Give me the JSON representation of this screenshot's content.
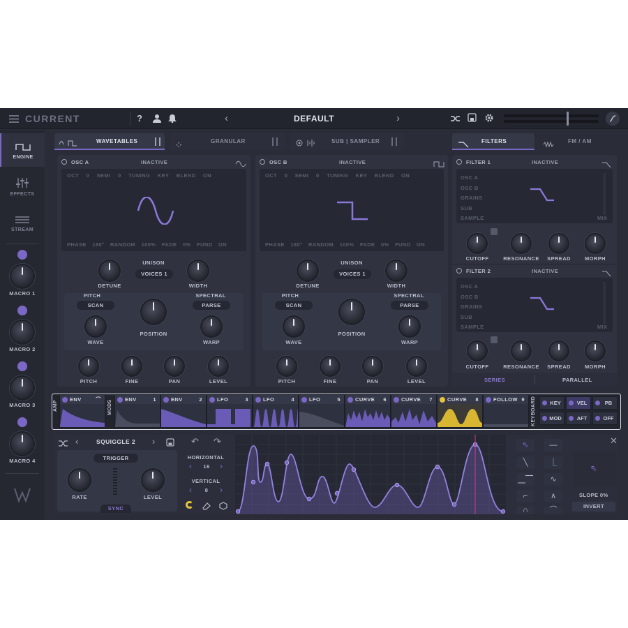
{
  "app": {
    "title": "CURRENT",
    "preset": "DEFAULT"
  },
  "topbar": {
    "help": "?",
    "prev": "‹",
    "next": "›"
  },
  "sidebar": {
    "items": [
      {
        "label": "ENGINE",
        "icon": "engine-wave-icon"
      },
      {
        "label": "EFFECTS",
        "icon": "effects-sliders-icon"
      },
      {
        "label": "STREAM",
        "icon": "stream-icon"
      }
    ],
    "macros": [
      "MACRO 1",
      "MACRO 2",
      "MACRO 3",
      "MACRO 4"
    ]
  },
  "tabs": {
    "wavetables": "WAVETABLES",
    "granular": "GRANULAR",
    "sub_sampler": "SUB | SAMPLER",
    "filters": "FILTERS",
    "fm_am": "FM / AM"
  },
  "osc_a": {
    "name": "OSC A",
    "state": "INACTIVE",
    "params_top": [
      "OCT",
      "0",
      "SEMI",
      "0",
      "TUNING",
      "KEY",
      "BLEND",
      "ON"
    ],
    "params_bottom": [
      "PHASE",
      "180°",
      "RANDOM",
      "100%",
      "FADE",
      "0%",
      "FUND",
      "ON"
    ],
    "unison": "UNISON",
    "voices_label": "VOICES",
    "voices": "1",
    "detune": "DETUNE",
    "width": "WIDTH",
    "pitch_label": "PITCH",
    "pitch_mode": "SCAN",
    "spectral_label": "SPECTRAL",
    "spectral_mode": "PARSE",
    "wave": "WAVE",
    "position": "POSITION",
    "warp": "WARP",
    "pitch": "PITCH",
    "fine": "FINE",
    "pan": "PAN",
    "level": "LEVEL"
  },
  "osc_b": {
    "name": "OSC B",
    "state": "INACTIVE",
    "params_top": [
      "OCT",
      "0",
      "SEMI",
      "0",
      "TUNING",
      "KEY",
      "BLEND",
      "ON"
    ],
    "params_bottom": [
      "PHASE",
      "180°",
      "RANDOM",
      "100%",
      "FADE",
      "0%",
      "FUND",
      "ON"
    ],
    "unison": "UNISON",
    "voices_label": "VOICES",
    "voices": "1",
    "detune": "DETUNE",
    "width": "WIDTH",
    "pitch_label": "PITCH",
    "pitch_mode": "SCAN",
    "spectral_label": "SPECTRAL",
    "spectral_mode": "PARSE",
    "wave": "WAVE",
    "position": "POSITION",
    "warp": "WARP",
    "pitch": "PITCH",
    "fine": "FINE",
    "pan": "PAN",
    "level": "LEVEL"
  },
  "filter1": {
    "name": "FILTER 1",
    "state": "INACTIVE",
    "routes": [
      "OSC A",
      "OSC B",
      "GRAINS",
      "SUB",
      "SAMPLE"
    ],
    "mix": "MIX",
    "cutoff": "CUTOFF",
    "resonance": "RESONANCE",
    "spread": "SPREAD",
    "morph": "MORPH"
  },
  "filter2": {
    "name": "FILTER 2",
    "state": "INACTIVE",
    "routes": [
      "OSC A",
      "OSC B",
      "GRAINS",
      "SUB",
      "SAMPLE"
    ],
    "mix": "MIX",
    "cutoff": "CUTOFF",
    "resonance": "RESONANCE",
    "spread": "SPREAD",
    "morph": "MORPH"
  },
  "filter_mode": {
    "series": "SERIES",
    "parallel": "PARALLEL"
  },
  "mod_strip": {
    "amp": "AMP",
    "mods": "MODS",
    "keyboard": "KEYBOARD",
    "amp_env": {
      "label": "ENV"
    },
    "slots": [
      {
        "label": "ENV",
        "num": "1"
      },
      {
        "label": "ENV",
        "num": "2"
      },
      {
        "label": "LFO",
        "num": "3"
      },
      {
        "label": "LFO",
        "num": "4"
      },
      {
        "label": "LFO",
        "num": "5"
      },
      {
        "label": "CURVE",
        "num": "6"
      },
      {
        "label": "CURVE",
        "num": "7"
      },
      {
        "label": "CURVE",
        "num": "8"
      },
      {
        "label": "FOLLOW",
        "num": "9"
      }
    ],
    "keys": [
      "KEY",
      "VEL",
      "PB",
      "MOD",
      "AFT",
      "OFF"
    ]
  },
  "lfo_editor": {
    "preset": "SQUIGGLE 2",
    "trigger": "TRIGGER",
    "rate": "RATE",
    "level": "LEVEL",
    "sync": "SYNC",
    "horizontal": "HORIZONTAL",
    "horizontal_value": "16",
    "vertical": "VERTICAL",
    "vertical_value": "8",
    "slope": "SLOPE",
    "slope_value": "0%",
    "invert": "INVERT"
  },
  "colors": {
    "accent": "#7b68c6",
    "highlight": "#e5c43b",
    "panel": "#30333f",
    "bg": "#2a2d38"
  }
}
